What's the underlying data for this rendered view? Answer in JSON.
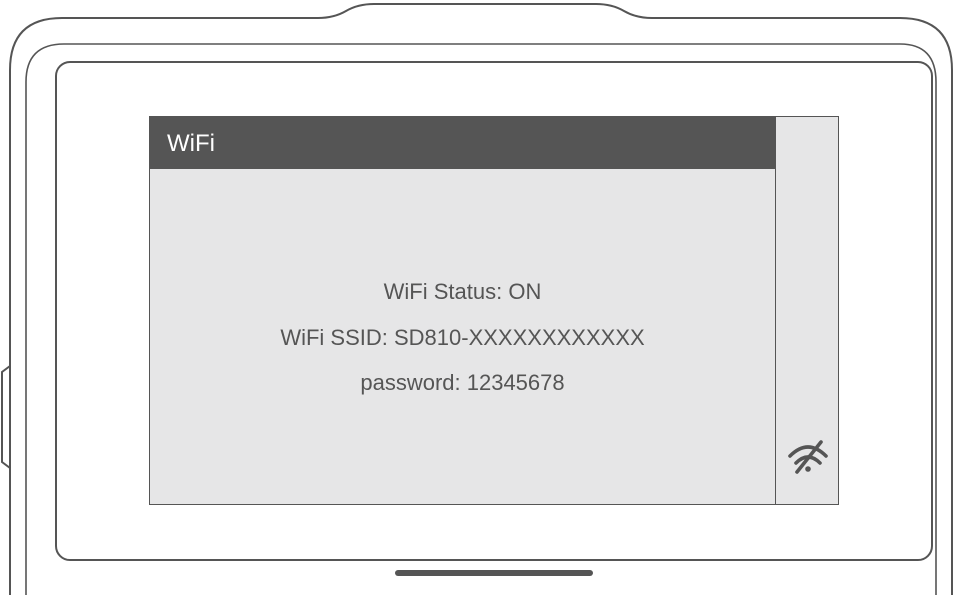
{
  "screen": {
    "title": "WiFi",
    "status_line": "WiFi Status: ON",
    "ssid_line": "WiFi SSID: SD810-XXXXXXXXXXXX",
    "password_line": "password: 12345678"
  },
  "side_strip": {
    "icon": "wifi-off-icon"
  },
  "colors": {
    "title_bar": "#555555",
    "panel_background": "#e6e6e7",
    "text": "#555555",
    "outline": "#555555"
  }
}
